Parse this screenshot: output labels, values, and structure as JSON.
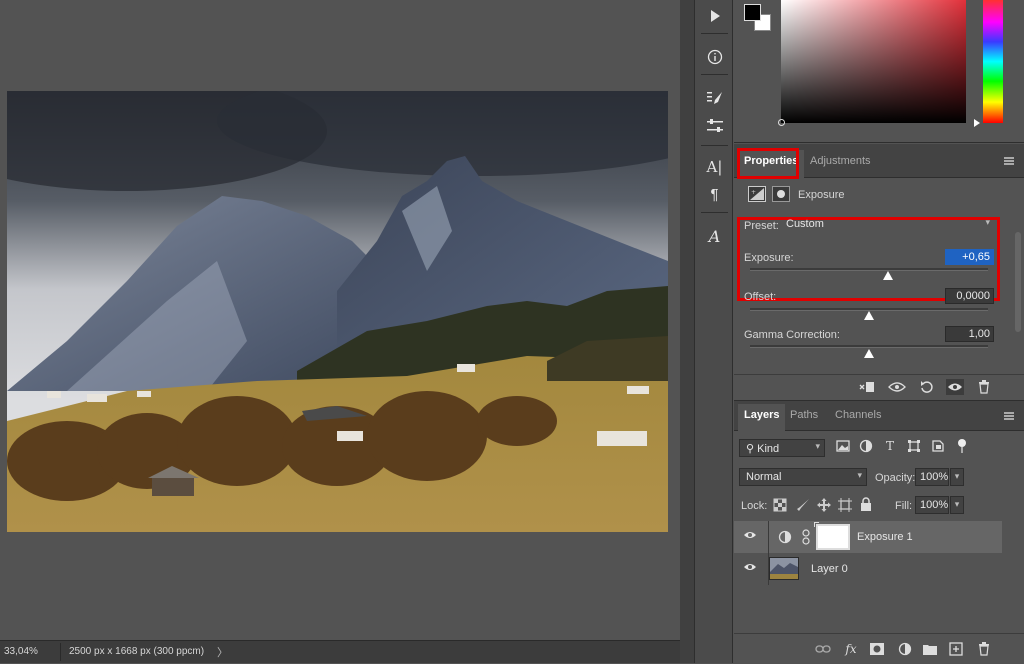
{
  "status": {
    "zoom": "33,04%",
    "doc_info": "2500 px x 1668 px (300 ppcm)",
    "chevron": "〉"
  },
  "tools": [
    {
      "name": "play",
      "glyph": "▶"
    },
    {
      "name": "info",
      "glyph": "ⓘ"
    },
    {
      "name": "brush-settings",
      "glyph": "⁝🖌"
    },
    {
      "name": "adjust-sliders",
      "glyph": "⚌"
    },
    {
      "name": "character",
      "glyph": "A|"
    },
    {
      "name": "paragraph",
      "glyph": "¶"
    },
    {
      "name": "glyphs",
      "glyph": "𝒜"
    }
  ],
  "properties": {
    "tabs": [
      {
        "label": "Properties",
        "active": true
      },
      {
        "label": "Adjustments",
        "active": false
      }
    ],
    "adjustment_name": "Exposure",
    "preset_label": "Preset:",
    "preset_value": "Custom",
    "exposure_label": "Exposure:",
    "exposure_value": "+0,65",
    "exposure_level": 0.58,
    "offset_label": "Offset:",
    "offset_value": "0,0000",
    "offset_level": 0.5,
    "gamma_label": "Gamma Correction:",
    "gamma_value": "1,00",
    "gamma_level": 0.5
  },
  "layers": {
    "tabs": [
      {
        "label": "Layers",
        "active": true
      },
      {
        "label": "Paths",
        "active": false
      },
      {
        "label": "Channels",
        "active": false
      }
    ],
    "filter_kind": "Kind",
    "blend_mode": "Normal",
    "opacity_label": "Opacity:",
    "opacity_value": "100%",
    "lock_label": "Lock:",
    "fill_label": "Fill:",
    "fill_value": "100%",
    "items": [
      {
        "name": "Exposure 1",
        "selected": true
      },
      {
        "name": "Layer 0",
        "selected": false
      }
    ]
  },
  "colors": {
    "highlight_red": "#e00000",
    "selection_blue": "#1f63c2",
    "panel_bg": "#535353"
  }
}
